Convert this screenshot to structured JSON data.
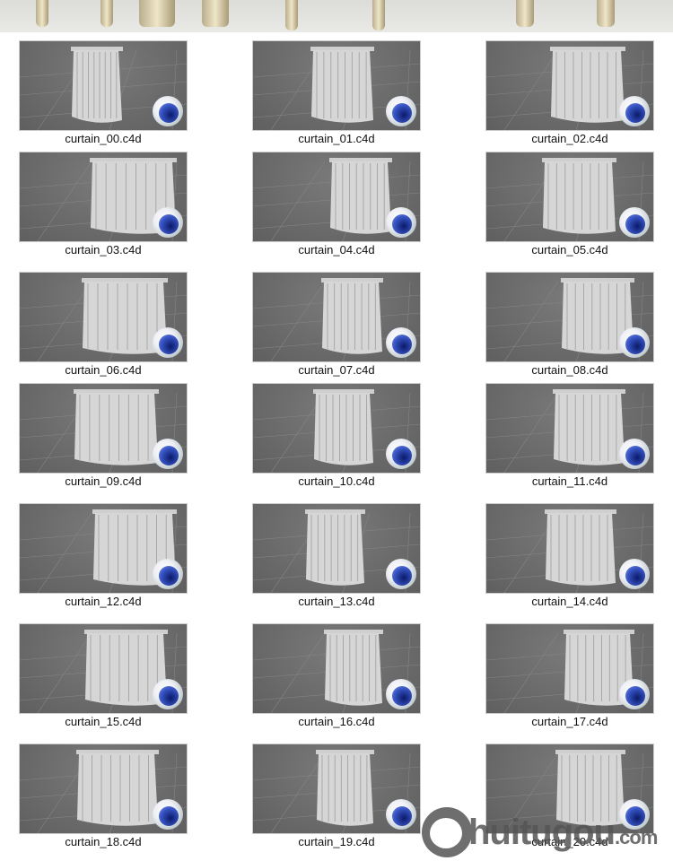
{
  "files": [
    "curtain_00.c4d",
    "curtain_01.c4d",
    "curtain_02.c4d",
    "curtain_03.c4d",
    "curtain_04.c4d",
    "curtain_05.c4d",
    "curtain_06.c4d",
    "curtain_07.c4d",
    "curtain_08.c4d",
    "curtain_09.c4d",
    "curtain_10.c4d",
    "curtain_11.c4d",
    "curtain_12.c4d",
    "curtain_13.c4d",
    "curtain_14.c4d",
    "curtain_15.c4d",
    "curtain_16.c4d",
    "curtain_17.c4d",
    "curtain_18.c4d",
    "curtain_19.c4d",
    "curtain_20.c4d"
  ],
  "watermark": {
    "name": "huitugou",
    "suffix": ".com"
  }
}
